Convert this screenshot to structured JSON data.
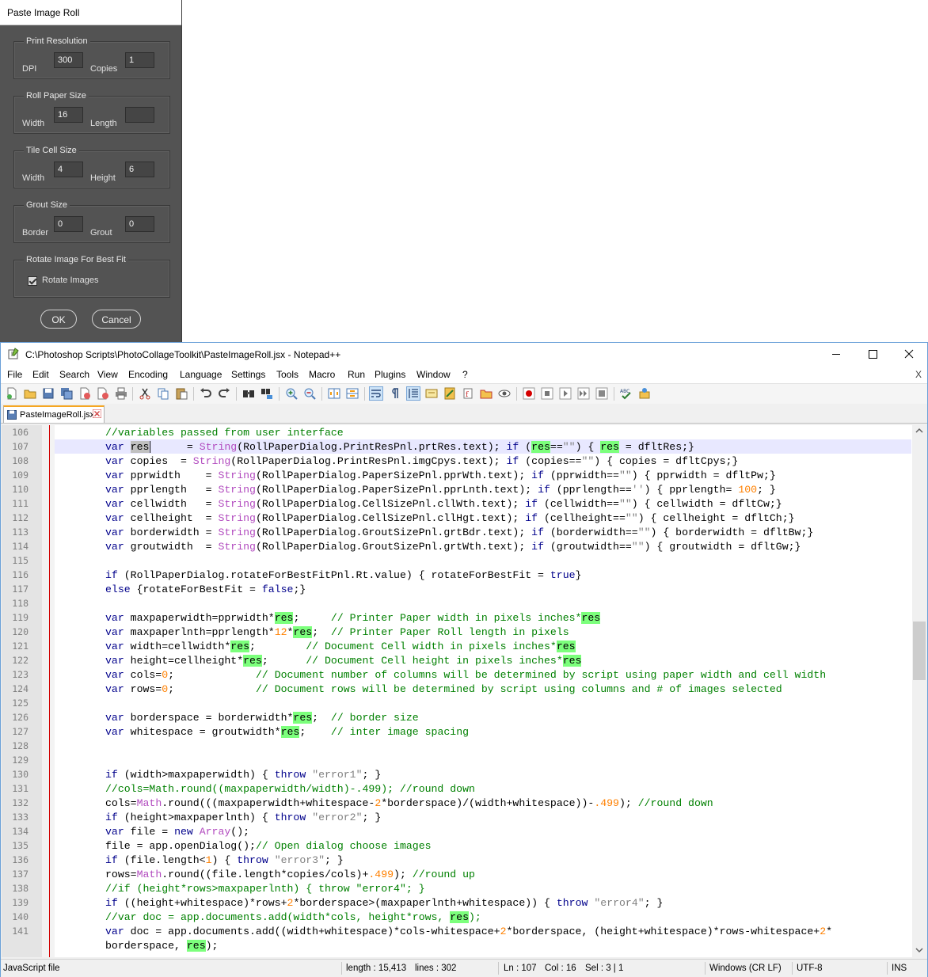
{
  "dialog": {
    "title": "Paste Image Roll",
    "groups": [
      {
        "title": "Print Resolution",
        "label1": "DPI",
        "value1": "300",
        "label2": "Copies",
        "value2": "1"
      },
      {
        "title": "Roll Paper Size",
        "label1": "Width",
        "value1": "16",
        "label2": "Length",
        "value2": ""
      },
      {
        "title": "Tile Cell Size",
        "label1": "Width",
        "value1": "4",
        "label2": "Height",
        "value2": "6"
      },
      {
        "title": "Grout Size",
        "label1": "Border",
        "value1": "0",
        "label2": "Grout",
        "value2": "0"
      }
    ],
    "rotate_group_title": "Rotate Image For Best Fit",
    "rotate_checkbox_label": "Rotate Images",
    "rotate_checked": true,
    "ok_label": "OK",
    "cancel_label": "Cancel"
  },
  "npp": {
    "title": "C:\\Photoshop Scripts\\PhotoCollageToolkit\\PasteImageRoll.jsx - Notepad++",
    "menu": [
      "File",
      "Edit",
      "Search",
      "View",
      "Encoding",
      "Language",
      "Settings",
      "Tools",
      "Macro",
      "Run",
      "Plugins",
      "Window",
      "?"
    ],
    "menu_close": "X",
    "tab_label": "PasteImageRoll.jsx",
    "toolbar_icons": [
      "new-file-icon",
      "open-file-icon",
      "save-icon",
      "save-all-icon",
      "close-icon",
      "close-all-icon",
      "print-icon",
      "cut-icon",
      "copy-icon",
      "paste-icon",
      "undo-icon",
      "redo-icon",
      "find-icon",
      "replace-icon",
      "zoom-in-icon",
      "zoom-out-icon",
      "sync-vertical-icon",
      "sync-horizontal-icon",
      "word-wrap-icon",
      "show-all-chars-icon",
      "indent-guide-icon",
      "udl-icon",
      "doc-map-icon",
      "function-list-icon",
      "folder-workspace-icon",
      "monitoring-icon",
      "record-macro-icon",
      "stop-macro-icon",
      "play-macro-icon",
      "run-macro-multiple-icon",
      "save-macro-icon",
      "spell-check-icon",
      "plugin-icon"
    ],
    "code_lines": [
      {
        "n": "106",
        "segs": [
          [
            "cm",
            "//variables passed from user interface"
          ]
        ]
      },
      {
        "n": "107",
        "segs": [
          [
            "kw",
            "var "
          ],
          [
            "sel",
            "res"
          ],
          [
            "",
            "      = "
          ],
          [
            "ty",
            "String"
          ],
          [
            "",
            "(RollPaperDialog.PrintResPnl.prtRes.text); "
          ],
          [
            "kw",
            "if"
          ],
          [
            "",
            " ("
          ],
          [
            "hl",
            "res"
          ],
          [
            "",
            "=="
          ],
          [
            "st",
            "\"\""
          ],
          [
            "",
            ") { "
          ],
          [
            "hl",
            "res"
          ],
          [
            "",
            " = dfltRes;}"
          ]
        ]
      },
      {
        "n": "108",
        "segs": [
          [
            "kw",
            "var "
          ],
          [
            "",
            "copies  = "
          ],
          [
            "ty",
            "String"
          ],
          [
            "",
            "(RollPaperDialog.PrintResPnl.imgCpys.text); "
          ],
          [
            "kw",
            "if"
          ],
          [
            "",
            " (copies=="
          ],
          [
            "st",
            "\"\""
          ],
          [
            "",
            ") { copies = dfltCpys;}"
          ]
        ]
      },
      {
        "n": "109",
        "segs": [
          [
            "kw",
            "var "
          ],
          [
            "",
            "pprwidth    = "
          ],
          [
            "ty",
            "String"
          ],
          [
            "",
            "(RollPaperDialog.PaperSizePnl.pprWth.text); "
          ],
          [
            "kw",
            "if"
          ],
          [
            "",
            " (pprwidth=="
          ],
          [
            "st",
            "\"\""
          ],
          [
            "",
            ") { pprwidth = dfltPw;}"
          ]
        ]
      },
      {
        "n": "110",
        "segs": [
          [
            "kw",
            "var "
          ],
          [
            "",
            "pprlength   = "
          ],
          [
            "ty",
            "String"
          ],
          [
            "",
            "(RollPaperDialog.PaperSizePnl.pprLnth.text); "
          ],
          [
            "kw",
            "if"
          ],
          [
            "",
            " (pprlength=="
          ],
          [
            "st",
            "''"
          ],
          [
            "",
            ") { pprlength= "
          ],
          [
            "nm",
            "100"
          ],
          [
            "",
            "; }"
          ]
        ]
      },
      {
        "n": "111",
        "segs": [
          [
            "kw",
            "var "
          ],
          [
            "",
            "cellwidth   = "
          ],
          [
            "ty",
            "String"
          ],
          [
            "",
            "(RollPaperDialog.CellSizePnl.cllWth.text); "
          ],
          [
            "kw",
            "if"
          ],
          [
            "",
            " (cellwidth=="
          ],
          [
            "st",
            "\"\""
          ],
          [
            "",
            ") { cellwidth = dfltCw;}"
          ]
        ]
      },
      {
        "n": "112",
        "segs": [
          [
            "kw",
            "var "
          ],
          [
            "",
            "cellheight  = "
          ],
          [
            "ty",
            "String"
          ],
          [
            "",
            "(RollPaperDialog.CellSizePnl.cllHgt.text); "
          ],
          [
            "kw",
            "if"
          ],
          [
            "",
            " (cellheight=="
          ],
          [
            "st",
            "\"\""
          ],
          [
            "",
            ") { cellheight = dfltCh;}"
          ]
        ]
      },
      {
        "n": "113",
        "segs": [
          [
            "kw",
            "var "
          ],
          [
            "",
            "borderwidth = "
          ],
          [
            "ty",
            "String"
          ],
          [
            "",
            "(RollPaperDialog.GroutSizePnl.grtBdr.text); "
          ],
          [
            "kw",
            "if"
          ],
          [
            "",
            " (borderwidth=="
          ],
          [
            "st",
            "\"\""
          ],
          [
            "",
            ") { borderwidth = dfltBw;}"
          ]
        ]
      },
      {
        "n": "114",
        "segs": [
          [
            "kw",
            "var "
          ],
          [
            "",
            "groutwidth  = "
          ],
          [
            "ty",
            "String"
          ],
          [
            "",
            "(RollPaperDialog.GroutSizePnl.grtWth.text); "
          ],
          [
            "kw",
            "if"
          ],
          [
            "",
            " (groutwidth=="
          ],
          [
            "st",
            "\"\""
          ],
          [
            "",
            ") { groutwidth = dfltGw;}"
          ]
        ]
      },
      {
        "n": "115",
        "segs": []
      },
      {
        "n": "116",
        "segs": [
          [
            "kw",
            "if"
          ],
          [
            "",
            " (RollPaperDialog.rotateForBestFitPnl.Rt.value) { rotateForBestFit = "
          ],
          [
            "kw",
            "true"
          ],
          [
            "",
            "}"
          ]
        ]
      },
      {
        "n": "117",
        "segs": [
          [
            "kw",
            "else"
          ],
          [
            "",
            " {rotateForBestFit = "
          ],
          [
            "kw",
            "false"
          ],
          [
            "",
            ";}"
          ]
        ]
      },
      {
        "n": "118",
        "segs": []
      },
      {
        "n": "119",
        "segs": [
          [
            "kw",
            "var "
          ],
          [
            "",
            "maxpaperwidth=pprwidth*"
          ],
          [
            "hl",
            "res"
          ],
          [
            "",
            ";     "
          ],
          [
            "cm",
            "// Printer Paper width in pixels inches*"
          ],
          [
            "hl",
            "res"
          ]
        ]
      },
      {
        "n": "120",
        "segs": [
          [
            "kw",
            "var "
          ],
          [
            "",
            "maxpaperlnth=pprlength*"
          ],
          [
            "nm",
            "12"
          ],
          [
            "",
            "*"
          ],
          [
            "hl",
            "res"
          ],
          [
            "",
            ";  "
          ],
          [
            "cm",
            "// Printer Paper Roll length in pixels"
          ]
        ]
      },
      {
        "n": "121",
        "segs": [
          [
            "kw",
            "var "
          ],
          [
            "",
            "width=cellwidth*"
          ],
          [
            "hl",
            "res"
          ],
          [
            "",
            ";        "
          ],
          [
            "cm",
            "// Document Cell width in pixels inches*"
          ],
          [
            "hl",
            "res"
          ]
        ]
      },
      {
        "n": "122",
        "segs": [
          [
            "kw",
            "var "
          ],
          [
            "",
            "height=cellheight*"
          ],
          [
            "hl",
            "res"
          ],
          [
            "",
            ";      "
          ],
          [
            "cm",
            "// Document Cell height in pixels inches*"
          ],
          [
            "hl",
            "res"
          ]
        ]
      },
      {
        "n": "123",
        "segs": [
          [
            "kw",
            "var "
          ],
          [
            "",
            "cols="
          ],
          [
            "nm",
            "0"
          ],
          [
            "",
            ";             "
          ],
          [
            "cm",
            "// Document number of columns will be determined by script using paper width and cell width"
          ]
        ]
      },
      {
        "n": "124",
        "segs": [
          [
            "kw",
            "var "
          ],
          [
            "",
            "rows="
          ],
          [
            "nm",
            "0"
          ],
          [
            "",
            ";             "
          ],
          [
            "cm",
            "// Document rows will be determined by script using columns and # of images selected"
          ]
        ]
      },
      {
        "n": "125",
        "segs": []
      },
      {
        "n": "126",
        "segs": [
          [
            "kw",
            "var "
          ],
          [
            "",
            "borderspace = borderwidth*"
          ],
          [
            "hl",
            "res"
          ],
          [
            "",
            ";  "
          ],
          [
            "cm",
            "// border size"
          ]
        ]
      },
      {
        "n": "127",
        "segs": [
          [
            "kw",
            "var "
          ],
          [
            "",
            "whitespace = groutwidth*"
          ],
          [
            "hl",
            "res"
          ],
          [
            "",
            ";    "
          ],
          [
            "cm",
            "// inter image spacing"
          ]
        ]
      },
      {
        "n": "128",
        "segs": []
      },
      {
        "n": "129",
        "segs": []
      },
      {
        "n": "130",
        "segs": [
          [
            "kw",
            "if"
          ],
          [
            "",
            " (width>maxpaperwidth) { "
          ],
          [
            "kw",
            "throw"
          ],
          [
            "",
            " "
          ],
          [
            "st",
            "\"error1\""
          ],
          [
            "",
            "; }"
          ]
        ]
      },
      {
        "n": "131",
        "segs": [
          [
            "cm",
            "//cols=Math.round((maxpaperwidth/width)-.499); //round down"
          ]
        ]
      },
      {
        "n": "132",
        "segs": [
          [
            "",
            "cols="
          ],
          [
            "ty",
            "Math"
          ],
          [
            "",
            ".round(((maxpaperwidth+whitespace-"
          ],
          [
            "nm",
            "2"
          ],
          [
            "",
            "*borderspace)/(width+whitespace))-"
          ],
          [
            "nm",
            ".499"
          ],
          [
            "",
            "); "
          ],
          [
            "cm",
            "//round down"
          ]
        ]
      },
      {
        "n": "133",
        "segs": [
          [
            "kw",
            "if"
          ],
          [
            "",
            " (height>maxpaperlnth) { "
          ],
          [
            "kw",
            "throw"
          ],
          [
            "",
            " "
          ],
          [
            "st",
            "\"error2\""
          ],
          [
            "",
            "; }"
          ]
        ]
      },
      {
        "n": "134",
        "segs": [
          [
            "kw",
            "var "
          ],
          [
            "",
            "file = "
          ],
          [
            "kw",
            "new "
          ],
          [
            "ty",
            "Array"
          ],
          [
            "",
            "();"
          ]
        ]
      },
      {
        "n": "135",
        "segs": [
          [
            "",
            "file = app.openDialog();"
          ],
          [
            "cm",
            "// Open dialog choose images"
          ]
        ]
      },
      {
        "n": "136",
        "segs": [
          [
            "kw",
            "if"
          ],
          [
            "",
            " (file.length<"
          ],
          [
            "nm",
            "1"
          ],
          [
            "",
            ") { "
          ],
          [
            "kw",
            "throw"
          ],
          [
            "",
            " "
          ],
          [
            "st",
            "\"error3\""
          ],
          [
            "",
            "; }"
          ]
        ]
      },
      {
        "n": "137",
        "segs": [
          [
            "",
            "rows="
          ],
          [
            "ty",
            "Math"
          ],
          [
            "",
            ".round((file.length*copies/cols)+"
          ],
          [
            "nm",
            ".499"
          ],
          [
            "",
            "); "
          ],
          [
            "cm",
            "//round up"
          ]
        ]
      },
      {
        "n": "138",
        "segs": [
          [
            "cm",
            "//if (height*rows>maxpaperlnth) { throw \"error4\"; }"
          ]
        ]
      },
      {
        "n": "139",
        "segs": [
          [
            "kw",
            "if"
          ],
          [
            "",
            " ((height+whitespace)*rows+"
          ],
          [
            "nm",
            "2"
          ],
          [
            "",
            "*borderspace>(maxpaperlnth+whitespace)) { "
          ],
          [
            "kw",
            "throw"
          ],
          [
            "",
            " "
          ],
          [
            "st",
            "\"error4\""
          ],
          [
            "",
            "; }"
          ]
        ]
      },
      {
        "n": "140",
        "segs": [
          [
            "cm",
            "//var doc = app.documents.add(width*cols, height*rows, "
          ],
          [
            "hl",
            "res"
          ],
          [
            "cm",
            ");"
          ]
        ]
      },
      {
        "n": "141",
        "segs": [
          [
            "kw",
            "var "
          ],
          [
            "",
            "doc = app.documents.add((width+whitespace)*cols-whitespace+"
          ],
          [
            "nm",
            "2"
          ],
          [
            "",
            "*borderspace, (height+whitespace)*rows-whitespace+"
          ],
          [
            "nm",
            "2"
          ],
          [
            "",
            "*"
          ]
        ]
      },
      {
        "n": "",
        "segs": [
          [
            "",
            "borderspace, "
          ],
          [
            "hl",
            "res"
          ],
          [
            "",
            ");"
          ]
        ]
      }
    ],
    "status": {
      "file_type": "JavaScript file",
      "length": "length : 15,413",
      "lines": "lines : 302",
      "ln": "Ln : 107",
      "col": "Col : 16",
      "sel": "Sel : 3 | 1",
      "eol": "Windows (CR LF)",
      "encoding": "UTF-8",
      "mode": "INS"
    }
  }
}
